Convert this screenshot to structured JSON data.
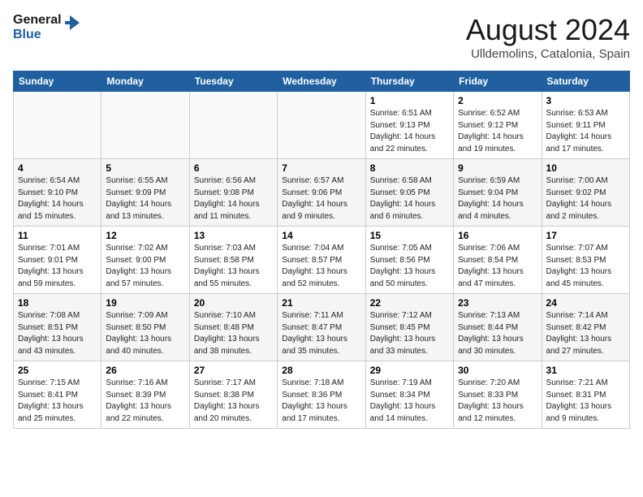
{
  "header": {
    "logo_line1": "General",
    "logo_line2": "Blue",
    "month_title": "August 2024",
    "location": "Ulldemolins, Catalonia, Spain"
  },
  "days_of_week": [
    "Sunday",
    "Monday",
    "Tuesday",
    "Wednesday",
    "Thursday",
    "Friday",
    "Saturday"
  ],
  "weeks": [
    [
      {
        "day": "",
        "info": ""
      },
      {
        "day": "",
        "info": ""
      },
      {
        "day": "",
        "info": ""
      },
      {
        "day": "",
        "info": ""
      },
      {
        "day": "1",
        "info": "Sunrise: 6:51 AM\nSunset: 9:13 PM\nDaylight: 14 hours\nand 22 minutes."
      },
      {
        "day": "2",
        "info": "Sunrise: 6:52 AM\nSunset: 9:12 PM\nDaylight: 14 hours\nand 19 minutes."
      },
      {
        "day": "3",
        "info": "Sunrise: 6:53 AM\nSunset: 9:11 PM\nDaylight: 14 hours\nand 17 minutes."
      }
    ],
    [
      {
        "day": "4",
        "info": "Sunrise: 6:54 AM\nSunset: 9:10 PM\nDaylight: 14 hours\nand 15 minutes."
      },
      {
        "day": "5",
        "info": "Sunrise: 6:55 AM\nSunset: 9:09 PM\nDaylight: 14 hours\nand 13 minutes."
      },
      {
        "day": "6",
        "info": "Sunrise: 6:56 AM\nSunset: 9:08 PM\nDaylight: 14 hours\nand 11 minutes."
      },
      {
        "day": "7",
        "info": "Sunrise: 6:57 AM\nSunset: 9:06 PM\nDaylight: 14 hours\nand 9 minutes."
      },
      {
        "day": "8",
        "info": "Sunrise: 6:58 AM\nSunset: 9:05 PM\nDaylight: 14 hours\nand 6 minutes."
      },
      {
        "day": "9",
        "info": "Sunrise: 6:59 AM\nSunset: 9:04 PM\nDaylight: 14 hours\nand 4 minutes."
      },
      {
        "day": "10",
        "info": "Sunrise: 7:00 AM\nSunset: 9:02 PM\nDaylight: 14 hours\nand 2 minutes."
      }
    ],
    [
      {
        "day": "11",
        "info": "Sunrise: 7:01 AM\nSunset: 9:01 PM\nDaylight: 13 hours\nand 59 minutes."
      },
      {
        "day": "12",
        "info": "Sunrise: 7:02 AM\nSunset: 9:00 PM\nDaylight: 13 hours\nand 57 minutes."
      },
      {
        "day": "13",
        "info": "Sunrise: 7:03 AM\nSunset: 8:58 PM\nDaylight: 13 hours\nand 55 minutes."
      },
      {
        "day": "14",
        "info": "Sunrise: 7:04 AM\nSunset: 8:57 PM\nDaylight: 13 hours\nand 52 minutes."
      },
      {
        "day": "15",
        "info": "Sunrise: 7:05 AM\nSunset: 8:56 PM\nDaylight: 13 hours\nand 50 minutes."
      },
      {
        "day": "16",
        "info": "Sunrise: 7:06 AM\nSunset: 8:54 PM\nDaylight: 13 hours\nand 47 minutes."
      },
      {
        "day": "17",
        "info": "Sunrise: 7:07 AM\nSunset: 8:53 PM\nDaylight: 13 hours\nand 45 minutes."
      }
    ],
    [
      {
        "day": "18",
        "info": "Sunrise: 7:08 AM\nSunset: 8:51 PM\nDaylight: 13 hours\nand 43 minutes."
      },
      {
        "day": "19",
        "info": "Sunrise: 7:09 AM\nSunset: 8:50 PM\nDaylight: 13 hours\nand 40 minutes."
      },
      {
        "day": "20",
        "info": "Sunrise: 7:10 AM\nSunset: 8:48 PM\nDaylight: 13 hours\nand 38 minutes."
      },
      {
        "day": "21",
        "info": "Sunrise: 7:11 AM\nSunset: 8:47 PM\nDaylight: 13 hours\nand 35 minutes."
      },
      {
        "day": "22",
        "info": "Sunrise: 7:12 AM\nSunset: 8:45 PM\nDaylight: 13 hours\nand 33 minutes."
      },
      {
        "day": "23",
        "info": "Sunrise: 7:13 AM\nSunset: 8:44 PM\nDaylight: 13 hours\nand 30 minutes."
      },
      {
        "day": "24",
        "info": "Sunrise: 7:14 AM\nSunset: 8:42 PM\nDaylight: 13 hours\nand 27 minutes."
      }
    ],
    [
      {
        "day": "25",
        "info": "Sunrise: 7:15 AM\nSunset: 8:41 PM\nDaylight: 13 hours\nand 25 minutes."
      },
      {
        "day": "26",
        "info": "Sunrise: 7:16 AM\nSunset: 8:39 PM\nDaylight: 13 hours\nand 22 minutes."
      },
      {
        "day": "27",
        "info": "Sunrise: 7:17 AM\nSunset: 8:38 PM\nDaylight: 13 hours\nand 20 minutes."
      },
      {
        "day": "28",
        "info": "Sunrise: 7:18 AM\nSunset: 8:36 PM\nDaylight: 13 hours\nand 17 minutes."
      },
      {
        "day": "29",
        "info": "Sunrise: 7:19 AM\nSunset: 8:34 PM\nDaylight: 13 hours\nand 14 minutes."
      },
      {
        "day": "30",
        "info": "Sunrise: 7:20 AM\nSunset: 8:33 PM\nDaylight: 13 hours\nand 12 minutes."
      },
      {
        "day": "31",
        "info": "Sunrise: 7:21 AM\nSunset: 8:31 PM\nDaylight: 13 hours\nand 9 minutes."
      }
    ]
  ]
}
